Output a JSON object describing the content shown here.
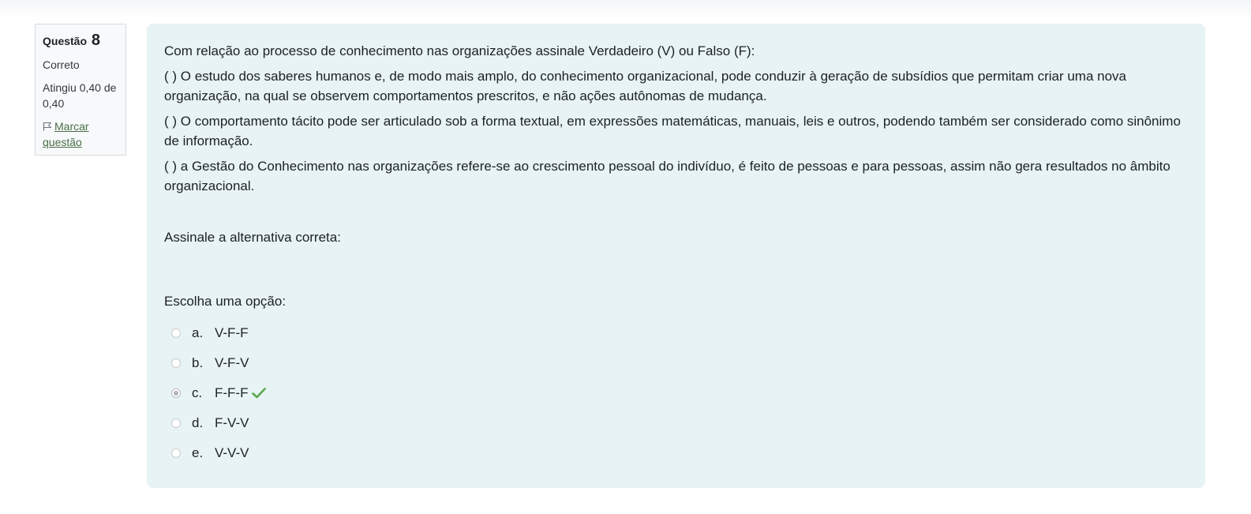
{
  "info": {
    "question_label": "Questão",
    "question_number": "8",
    "state": "Correto",
    "grade": "Atingiu 0,40 de 0,40",
    "flag_label": "Marcar questão"
  },
  "question": {
    "intro": "Com relação ao processo de conhecimento nas organizações assinale Verdadeiro (V) ou Falso (F):",
    "statements": [
      "(   ) O estudo dos saberes humanos e, de modo mais amplo, do conhecimento organizacional, pode conduzir à geração de subsídios que permitam criar uma nova organização, na qual se observem comportamentos prescritos, e não ações autônomas de mudança.",
      "(   ) O comportamento tácito pode ser articulado sob a forma textual, em expressões matemáticas, manuais, leis e outros, podendo também ser considerado como sinônimo de informação.",
      "(   ) a Gestão do Conhecimento nas organizações refere-se ao crescimento pessoal do indivíduo, é feito de pessoas e para pessoas, assim não gera resultados no âmbito organizacional."
    ],
    "instruction": "Assinale a alternativa correta:"
  },
  "answer": {
    "prompt": "Escolha uma opção:",
    "options": [
      {
        "letter": "a.",
        "text": "V-F-F"
      },
      {
        "letter": "b.",
        "text": "V-F-V"
      },
      {
        "letter": "c.",
        "text": "F-F-F"
      },
      {
        "letter": "d.",
        "text": "F-V-V"
      },
      {
        "letter": "e.",
        "text": "V-V-V"
      }
    ],
    "selected": "c.",
    "correct_mark_color": "#5aa84a"
  },
  "colors": {
    "content_bg": "#e7f3f5",
    "info_bg": "#f8f9fa",
    "link": "#4a6f48"
  }
}
